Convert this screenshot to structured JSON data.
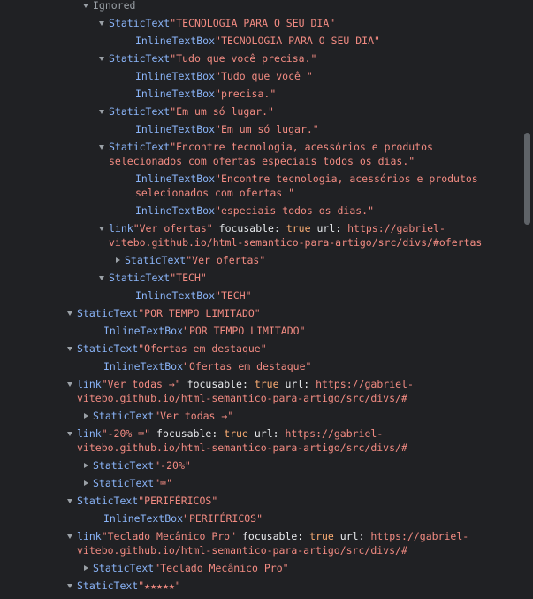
{
  "rows": [
    {
      "indent": 93,
      "arrow": "down",
      "type": "ignored",
      "text": "Ignored"
    },
    {
      "indent": 111,
      "arrow": "down",
      "type": "node",
      "role": "StaticText",
      "name": "\"TECNOLOGIA PARA O SEU DIA\""
    },
    {
      "indent": 141,
      "arrow": "",
      "type": "node",
      "role": "InlineTextBox",
      "name": "\"TECNOLOGIA PARA O SEU DIA\""
    },
    {
      "indent": 111,
      "arrow": "down",
      "type": "node",
      "role": "StaticText",
      "name": "\"Tudo que você precisa.\""
    },
    {
      "indent": 141,
      "arrow": "",
      "type": "node",
      "role": "InlineTextBox",
      "name": "\"Tudo que você \""
    },
    {
      "indent": 141,
      "arrow": "",
      "type": "node",
      "role": "InlineTextBox",
      "name": "\"precisa.\""
    },
    {
      "indent": 111,
      "arrow": "down",
      "type": "node",
      "role": "StaticText",
      "name": "\"Em um só lugar.\""
    },
    {
      "indent": 141,
      "arrow": "",
      "type": "node",
      "role": "InlineTextBox",
      "name": "\"Em um só lugar.\""
    },
    {
      "indent": 111,
      "arrow": "down",
      "type": "node",
      "wrap": true,
      "role": "StaticText",
      "name": "\"Encontre tecnologia, acessórios e produtos selecionados com ofertas especiais todos os dias.\""
    },
    {
      "indent": 141,
      "arrow": "",
      "type": "node",
      "wrap": true,
      "role": "InlineTextBox",
      "name": "\"Encontre tecnologia, acessórios e produtos selecionados com ofertas \""
    },
    {
      "indent": 141,
      "arrow": "",
      "type": "node",
      "role": "InlineTextBox",
      "name": "\"especiais todos os dias.\""
    },
    {
      "indent": 111,
      "arrow": "down",
      "type": "node",
      "wrap": true,
      "role": "link",
      "name": "\"Ver ofertas\"",
      "props": [
        {
          "k": "focusable",
          "v": "true"
        },
        {
          "k": "url",
          "v": "https://gabriel-vitebo.github.io/html-semantico-para-artigo/src/divs/#ofertas"
        }
      ]
    },
    {
      "indent": 129,
      "arrow": "right",
      "type": "node",
      "role": "StaticText",
      "name": "\"Ver ofertas\""
    },
    {
      "indent": 111,
      "arrow": "down",
      "type": "node",
      "role": "StaticText",
      "name": "\"TECH\""
    },
    {
      "indent": 141,
      "arrow": "",
      "type": "node",
      "role": "InlineTextBox",
      "name": "\"TECH\""
    },
    {
      "indent": 75,
      "arrow": "down",
      "type": "node",
      "role": "StaticText",
      "name": "\"POR TEMPO LIMITADO\""
    },
    {
      "indent": 105,
      "arrow": "",
      "type": "node",
      "role": "InlineTextBox",
      "name": "\"POR TEMPO LIMITADO\""
    },
    {
      "indent": 75,
      "arrow": "down",
      "type": "node",
      "role": "StaticText",
      "name": "\"Ofertas em destaque\""
    },
    {
      "indent": 105,
      "arrow": "",
      "type": "node",
      "role": "InlineTextBox",
      "name": "\"Ofertas em destaque\""
    },
    {
      "indent": 75,
      "arrow": "down",
      "type": "node",
      "wrap": true,
      "role": "link",
      "name": "\"Ver todas →\"",
      "props": [
        {
          "k": "focusable",
          "v": "true"
        },
        {
          "k": "url",
          "v": "https://gabriel-vitebo.github.io/html-semantico-para-artigo/src/divs/#"
        }
      ]
    },
    {
      "indent": 93,
      "arrow": "right",
      "type": "node",
      "role": "StaticText",
      "name": "\"Ver todas →\""
    },
    {
      "indent": 75,
      "arrow": "down",
      "type": "node",
      "wrap": true,
      "role": "link",
      "name": "\"-20% ⌨\"",
      "props": [
        {
          "k": "focusable",
          "v": "true"
        },
        {
          "k": "url",
          "v": "https://gabriel-vitebo.github.io/html-semantico-para-artigo/src/divs/#"
        }
      ]
    },
    {
      "indent": 93,
      "arrow": "right",
      "type": "node",
      "role": "StaticText",
      "name": "\"-20%\""
    },
    {
      "indent": 93,
      "arrow": "right",
      "type": "node",
      "role": "StaticText",
      "name": "\"⌨\""
    },
    {
      "indent": 75,
      "arrow": "down",
      "type": "node",
      "role": "StaticText",
      "name": "\"PERIFÉRICOS\""
    },
    {
      "indent": 105,
      "arrow": "",
      "type": "node",
      "role": "InlineTextBox",
      "name": "\"PERIFÉRICOS\""
    },
    {
      "indent": 75,
      "arrow": "down",
      "type": "node",
      "wrap": true,
      "role": "link",
      "name": "\"Teclado Mecânico Pro\"",
      "props": [
        {
          "k": "focusable",
          "v": "true"
        },
        {
          "k": "url",
          "v": "https://gabriel-vitebo.github.io/html-semantico-para-artigo/src/divs/#"
        }
      ]
    },
    {
      "indent": 93,
      "arrow": "right",
      "type": "node",
      "role": "StaticText",
      "name": "\"Teclado Mecânico Pro\""
    },
    {
      "indent": 75,
      "arrow": "down",
      "type": "node",
      "role": "StaticText",
      "name": "\"★★★★★\""
    }
  ]
}
